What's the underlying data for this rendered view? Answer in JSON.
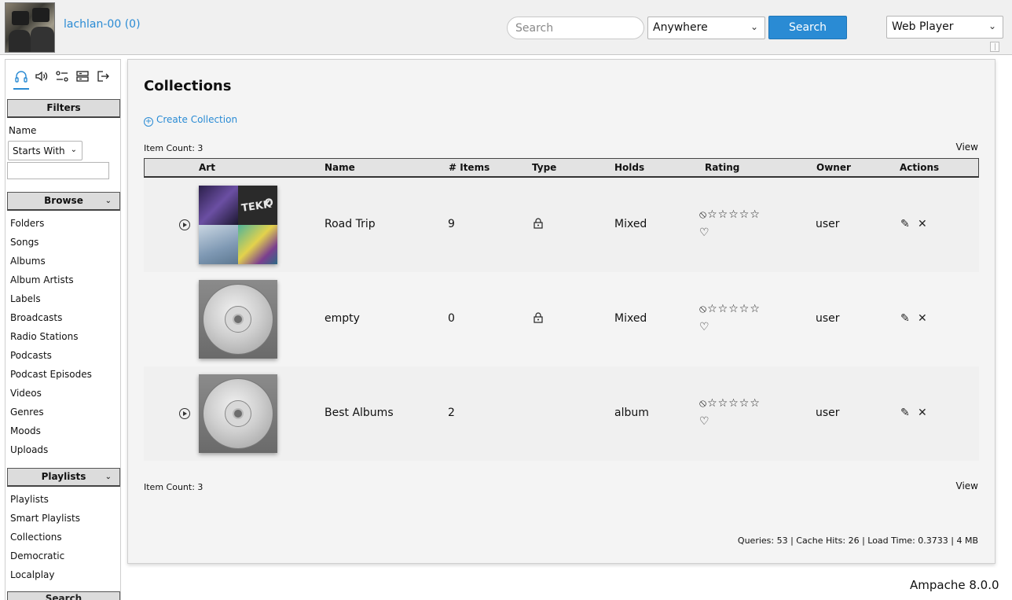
{
  "header": {
    "username": "lachlan-00 (0)",
    "search_placeholder": "Search",
    "search_scope": "Anywhere",
    "search_button": "Search",
    "player_mode": "Web Player"
  },
  "sidebar": {
    "tabs": [
      "headphones-icon",
      "speaker-icon",
      "preferences-icon",
      "admin-icon",
      "logout-icon"
    ],
    "filters": {
      "title": "Filters",
      "name_label": "Name",
      "match_mode": "Starts With"
    },
    "browse": {
      "title": "Browse",
      "items": [
        "Folders",
        "Songs",
        "Albums",
        "Album Artists",
        "Labels",
        "Broadcasts",
        "Radio Stations",
        "Podcasts",
        "Podcast Episodes",
        "Videos",
        "Genres",
        "Moods",
        "Uploads"
      ]
    },
    "playlists": {
      "title": "Playlists",
      "items": [
        "Playlists",
        "Smart Playlists",
        "Collections",
        "Democratic",
        "Localplay"
      ]
    },
    "next_section": "Search"
  },
  "main": {
    "title": "Collections",
    "create_label": "Create Collection",
    "item_count_label": "Item Count: 3",
    "view_label": "View",
    "columns": [
      "Art",
      "Name",
      "# Items",
      "Type",
      "Holds",
      "Rating",
      "Owner",
      "Actions"
    ],
    "rows": [
      {
        "name": "Road Trip",
        "items": "9",
        "holds": "Mixed",
        "owner": "user",
        "playable": true,
        "locked": true,
        "art": "mosaic"
      },
      {
        "name": "empty",
        "items": "0",
        "holds": "Mixed",
        "owner": "user",
        "playable": false,
        "locked": true,
        "art": "cd"
      },
      {
        "name": "Best Albums",
        "items": "2",
        "holds": "album",
        "owner": "user",
        "playable": true,
        "locked": false,
        "art": "cd"
      }
    ],
    "stats": "Queries: 53 | Cache Hits: 26 | Load Time: 0.3733 | 4 MB"
  },
  "footer": {
    "version": "Ampache 8.0.0"
  },
  "colors": {
    "accent": "#2a8bd4"
  }
}
